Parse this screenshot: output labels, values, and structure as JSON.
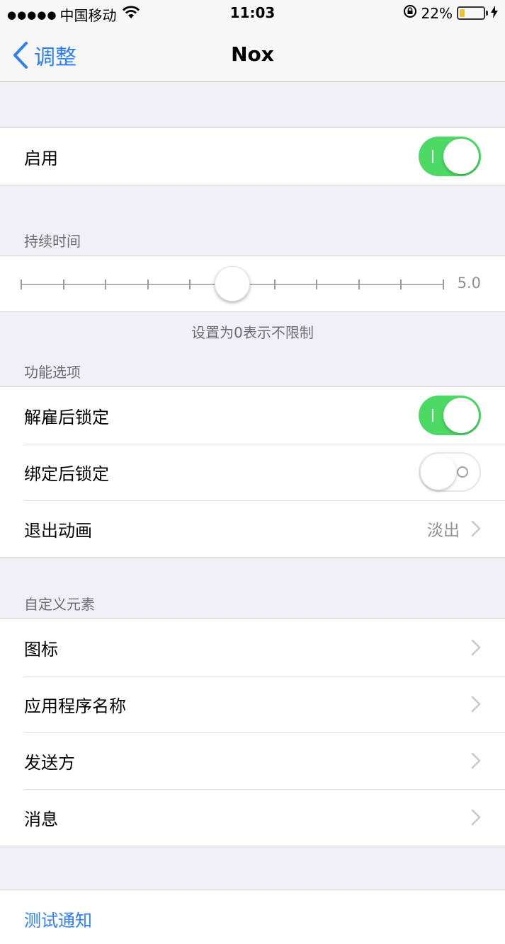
{
  "status_bar": {
    "signal": "●●●●●",
    "carrier": "中国移动",
    "time": "11:03",
    "battery_percent": "22%",
    "battery_level": 0.22,
    "icons": [
      "wifi-icon",
      "rotation-lock-icon",
      "battery-icon",
      "charging-bolt-icon"
    ]
  },
  "nav": {
    "back_label": "调整",
    "title": "Nox"
  },
  "enable_section": {
    "label": "启用",
    "value": true
  },
  "duration_section": {
    "header": "持续时间",
    "slider_value": 5.0,
    "slider_value_label": "5.0",
    "slider_min": 0,
    "slider_max": 10,
    "footer": "设置为0表示不限制"
  },
  "features_section": {
    "header": "功能选项",
    "items": [
      {
        "label": "解雇后锁定",
        "type": "switch",
        "value": true
      },
      {
        "label": "绑定后锁定",
        "type": "switch",
        "value": false
      },
      {
        "label": "退出动画",
        "type": "disclosure",
        "value": "淡出"
      }
    ]
  },
  "custom_section": {
    "header": "自定义元素",
    "items": [
      {
        "label": "图标"
      },
      {
        "label": "应用程序名称"
      },
      {
        "label": "发送方"
      },
      {
        "label": "消息"
      }
    ]
  },
  "test_section": {
    "label": "测试通知"
  },
  "colors": {
    "accent": "#2f7ff5",
    "switch_on": "#4cd964",
    "background": "#efeff4"
  }
}
